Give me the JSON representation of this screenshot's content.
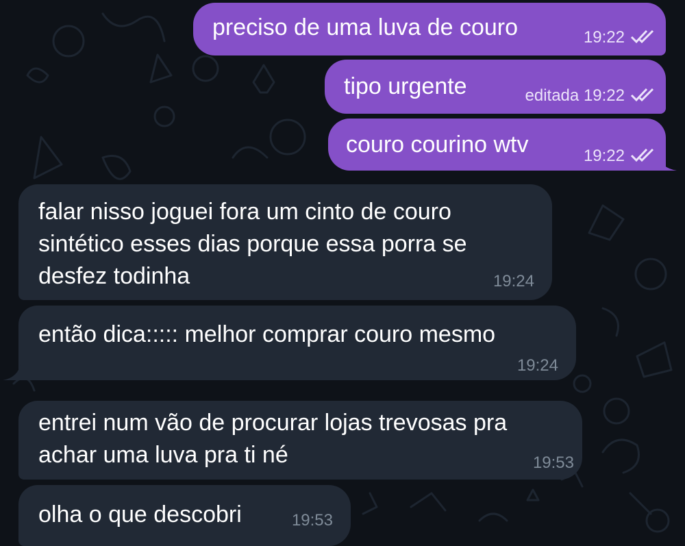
{
  "colors": {
    "background": "#0e1218",
    "outgoing_bubble": "#8550c8",
    "incoming_bubble": "#212935",
    "text": "#ffffff",
    "incoming_time": "#7f8b98"
  },
  "messages": [
    {
      "direction": "outgoing",
      "text": "preciso de uma luva de couro",
      "time": "19:22",
      "status_icon": "double-check-icon"
    },
    {
      "direction": "outgoing",
      "text": "tipo urgente",
      "edited_label": "editada",
      "time": "19:22",
      "status_icon": "double-check-icon"
    },
    {
      "direction": "outgoing",
      "text": "couro courino wtv",
      "time": "19:22",
      "status_icon": "double-check-icon"
    },
    {
      "direction": "incoming",
      "lines": [
        "falar nisso joguei fora um cinto de couro",
        "sintético esses dias porque essa porra se",
        "desfez todinha"
      ],
      "time": "19:24"
    },
    {
      "direction": "incoming",
      "text": "então dica::::: melhor comprar couro mesmo",
      "time": "19:24"
    },
    {
      "direction": "incoming",
      "lines": [
        "entrei num vão de procurar lojas trevosas pra",
        "achar uma luva pra ti né"
      ],
      "time": "19:53"
    },
    {
      "direction": "incoming",
      "text": "olha o que descobri",
      "time": "19:53"
    }
  ]
}
